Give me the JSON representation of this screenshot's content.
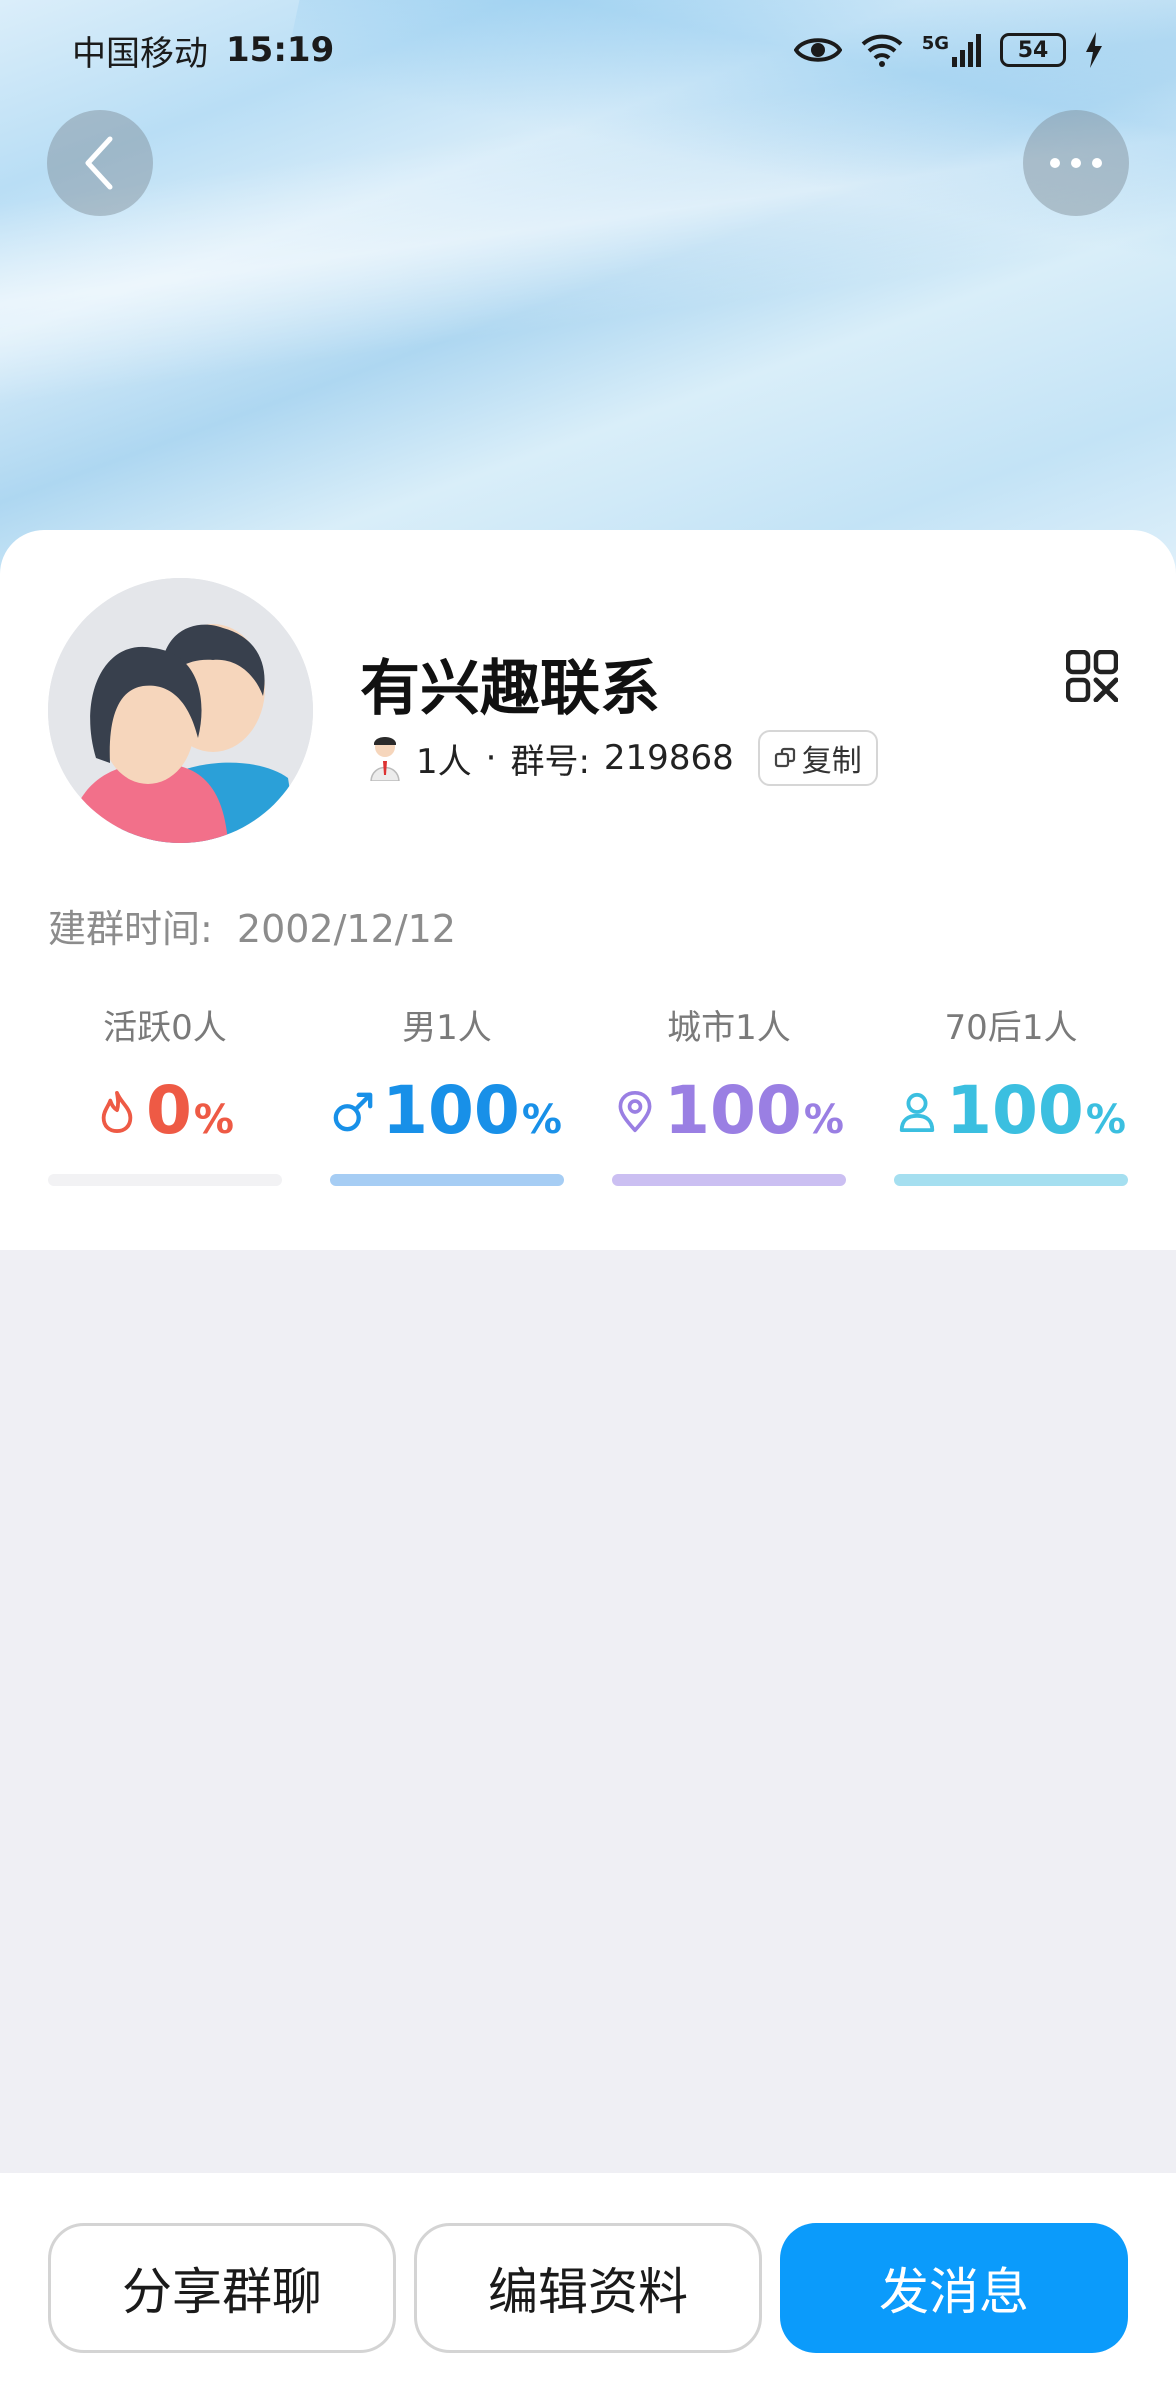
{
  "status_bar": {
    "carrier": "中国移动",
    "time": "15:19",
    "network": "5G",
    "battery": "54"
  },
  "header": {
    "back_icon": "chevron-left-icon",
    "more_icon": "more-horizontal-icon"
  },
  "group": {
    "name": "有兴趣联系",
    "members": "1人",
    "separator": "·",
    "id_label": "群号:",
    "id": "219868",
    "copy_label": "复制",
    "created_label": "建群时间:",
    "created_date": "2002/12/12"
  },
  "stats": [
    {
      "label": "活跃",
      "count": "0人",
      "value": "0",
      "unit": "%",
      "percent": 0,
      "color": "#ee5a45",
      "bar_color": "#f2f2f4",
      "icon": "flame-icon"
    },
    {
      "label": "男",
      "count": "1人",
      "value": "100",
      "unit": "%",
      "percent": 100,
      "color": "#1890e8",
      "bar_color": "#a6cdf4",
      "icon": "male-icon"
    },
    {
      "label": "城市",
      "count": "1人",
      "value": "100",
      "unit": "%",
      "percent": 100,
      "color": "#9a7fe3",
      "bar_color": "#cbbff2",
      "icon": "location-pin-icon"
    },
    {
      "label": "70后",
      "count": "1人",
      "value": "100",
      "unit": "%",
      "percent": 100,
      "color": "#3bbfe0",
      "bar_color": "#a5dff0",
      "icon": "person-icon"
    }
  ],
  "actions": {
    "share": "分享群聊",
    "edit": "编辑资料",
    "message": "发消息"
  },
  "colors": {
    "primary": "#0b9bfb",
    "page_bg": "#efeff4"
  }
}
